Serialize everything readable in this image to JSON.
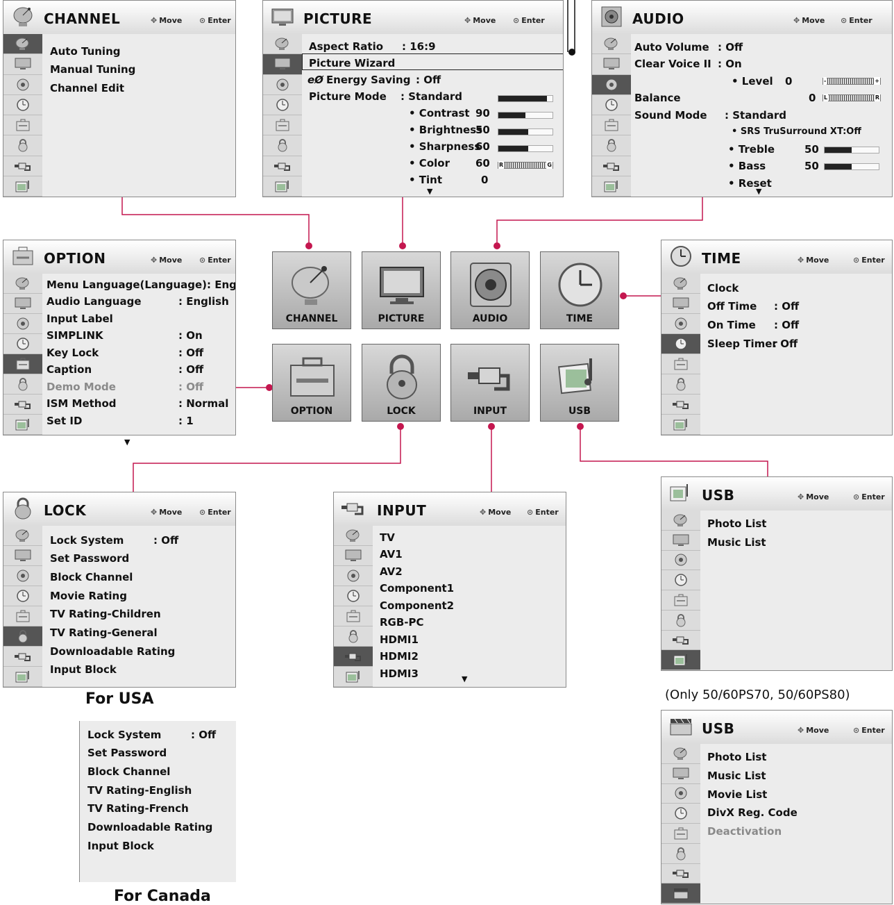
{
  "hints": {
    "move": "Move",
    "enter": "Enter"
  },
  "accent_color": "#c4174f",
  "sidebar_icons": [
    "satellite-icon",
    "monitor-icon",
    "speaker-icon",
    "clock-icon",
    "toolbox-icon",
    "lock-icon",
    "plug-icon",
    "photo-icon"
  ],
  "channel": {
    "title": "CHANNEL",
    "items": [
      "Auto Tuning",
      "Manual Tuning",
      "Channel Edit"
    ]
  },
  "picture": {
    "title": "PICTURE",
    "aspect_label": "Aspect Ratio",
    "aspect_value": ": 16:9",
    "wizard": "Picture Wizard",
    "energy_icon": "eco-icon",
    "energy_label": "Energy Saving",
    "energy_value": ": Off",
    "mode_label": "Picture Mode",
    "mode_value": ": Standard",
    "contrast_label": "• Contrast",
    "contrast_value": "90",
    "brightness_label": "• Brightness",
    "brightness_value": "50",
    "sharpness_label": "• Sharpness",
    "sharpness_value": "60",
    "color_label": "• Color",
    "color_value": "60",
    "color_scale_left": "R",
    "color_scale_right": "G",
    "tint_label": "• Tint",
    "tint_value": "0",
    "levels": {
      "picture_mode": 0.9,
      "contrast": 0.5,
      "brightness": 0.55,
      "sharpness": 0.55
    }
  },
  "audio": {
    "title": "AUDIO",
    "auto_volume_label": "Auto Volume",
    "auto_volume_value": ": Off",
    "clear_voice_label": "Clear Voice II",
    "clear_voice_value": ": On",
    "level_label": "• Level",
    "level_value": "0",
    "level_scale_left": "-",
    "level_scale_right": "+",
    "balance_label": "Balance",
    "balance_value": "0",
    "balance_scale_left": "L",
    "balance_scale_right": "R",
    "sound_mode_label": "Sound Mode",
    "sound_mode_value": ": Standard",
    "srs": "• SRS TruSurround XT:Off",
    "treble_label": "• Treble",
    "treble_value": "50",
    "bass_label": "• Bass",
    "bass_value": "50",
    "reset": "• Reset",
    "levels": {
      "treble": 0.5,
      "bass": 0.5
    }
  },
  "option": {
    "title": "OPTION",
    "rows": [
      {
        "label": "Menu Language(Language): English",
        "value": ""
      },
      {
        "label": "Audio Language",
        "value": ": English"
      },
      {
        "label": "Input Label",
        "value": ""
      },
      {
        "label": "SIMPLINK",
        "value": ": On"
      },
      {
        "label": "Key Lock",
        "value": ": Off"
      },
      {
        "label": "Caption",
        "value": ": Off"
      },
      {
        "label": "Demo Mode",
        "value": ": Off"
      },
      {
        "label": "ISM Method",
        "value": ": Normal"
      },
      {
        "label": "Set ID",
        "value": ": 1"
      }
    ]
  },
  "time": {
    "title": "TIME",
    "rows": [
      {
        "label": "Clock",
        "value": ""
      },
      {
        "label": "Off Time",
        "value": ": Off"
      },
      {
        "label": "On Time",
        "value": ": Off"
      },
      {
        "label": "Sleep Timer",
        "value": ": Off"
      }
    ]
  },
  "tiles": {
    "channel": "CHANNEL",
    "picture": "PICTURE",
    "audio": "AUDIO",
    "time": "TIME",
    "option": "OPTION",
    "lock": "LOCK",
    "input": "INPUT",
    "usb": "USB"
  },
  "lock": {
    "title": "LOCK",
    "rows": [
      {
        "label": "Lock System",
        "value": ": Off"
      },
      {
        "label": "Set Password",
        "value": ""
      },
      {
        "label": "Block Channel",
        "value": ""
      },
      {
        "label": "Movie Rating",
        "value": ""
      },
      {
        "label": "TV Rating-Children",
        "value": ""
      },
      {
        "label": "TV Rating-General",
        "value": ""
      },
      {
        "label": "Downloadable Rating",
        "value": ""
      },
      {
        "label": "Input Block",
        "value": ""
      }
    ],
    "usa_caption": "For USA"
  },
  "lock_canada": {
    "rows": [
      {
        "label": "Lock System",
        "value": ": Off"
      },
      {
        "label": "Set Password",
        "value": ""
      },
      {
        "label": "Block Channel",
        "value": ""
      },
      {
        "label": "TV Rating-English",
        "value": ""
      },
      {
        "label": "TV Rating-French",
        "value": ""
      },
      {
        "label": "Downloadable Rating",
        "value": ""
      },
      {
        "label": "Input Block",
        "value": ""
      }
    ],
    "caption": "For Canada"
  },
  "input": {
    "title": "INPUT",
    "items": [
      "TV",
      "AV1",
      "AV2",
      "Component1",
      "Component2",
      "RGB-PC",
      "HDMI1",
      "HDMI2",
      "HDMI3"
    ]
  },
  "usb": {
    "title": "USB",
    "items": [
      "Photo List",
      "Music List"
    ]
  },
  "usb2": {
    "note": "(Only 50/60PS70, 50/60PS80)",
    "title": "USB",
    "items": [
      "Photo List",
      "Music List",
      "Movie List",
      "DivX Reg. Code",
      "Deactivation"
    ]
  }
}
